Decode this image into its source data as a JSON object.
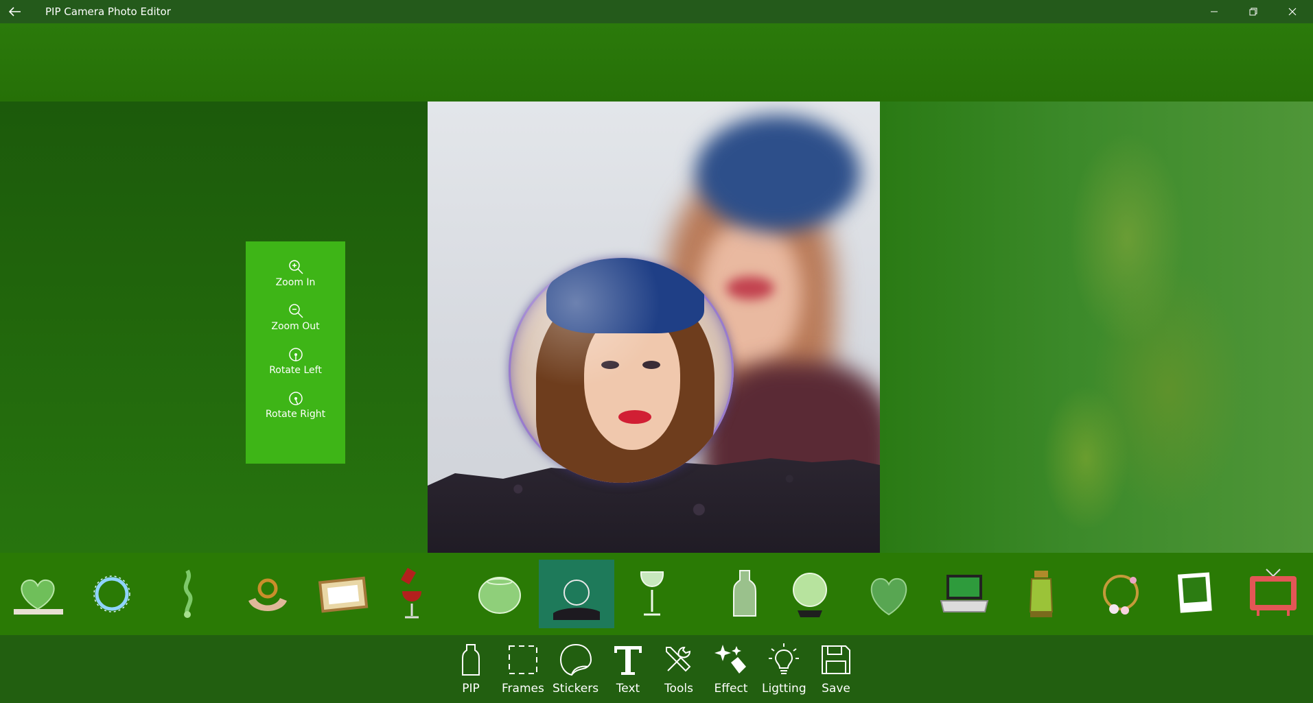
{
  "window": {
    "title": "PIP Camera Photo Editor",
    "back_icon": "back-arrow-icon",
    "controls": [
      "minimize-icon",
      "restore-icon",
      "close-icon"
    ]
  },
  "tools_panel": {
    "items": [
      {
        "label": "Zoom In",
        "icon": "zoom-in-icon"
      },
      {
        "label": "Zoom Out",
        "icon": "zoom-out-icon"
      },
      {
        "label": "Rotate Left",
        "icon": "rotate-left-icon"
      },
      {
        "label": "Rotate Right",
        "icon": "rotate-right-icon"
      }
    ]
  },
  "stickers": {
    "selected_index": 7,
    "items": [
      {
        "icon": "glass-heart-icon"
      },
      {
        "icon": "water-ring-icon"
      },
      {
        "icon": "water-splash-icon"
      },
      {
        "icon": "hands-ring-icon"
      },
      {
        "icon": "wooden-frame-icon"
      },
      {
        "icon": "wine-glass-pour-icon"
      },
      {
        "icon": "fishbowl-icon"
      },
      {
        "icon": "glass-bubble-on-rock-icon"
      },
      {
        "icon": "wine-glass-icon"
      },
      {
        "icon": "milk-bottle-icon"
      },
      {
        "icon": "crystal-ball-icon"
      },
      {
        "icon": "heart-glass-icon"
      },
      {
        "icon": "laptop-icon"
      },
      {
        "icon": "lantern-icon"
      },
      {
        "icon": "flower-wreath-icon"
      },
      {
        "icon": "polaroid-frame-icon"
      },
      {
        "icon": "red-tv-icon"
      }
    ]
  },
  "bottom_nav": {
    "items": [
      {
        "label": "PIP",
        "icon": "bottle-icon"
      },
      {
        "label": "Frames",
        "icon": "frames-icon"
      },
      {
        "label": "Stickers",
        "icon": "sticker-icon"
      },
      {
        "label": "Text",
        "icon": "text-icon"
      },
      {
        "label": "Tools",
        "icon": "tools-icon"
      },
      {
        "label": "Effect",
        "icon": "effect-icon"
      },
      {
        "label": "Ligtting",
        "icon": "lightbulb-icon"
      },
      {
        "label": "Save",
        "icon": "save-icon"
      }
    ]
  },
  "colors": {
    "accent_panel": "#3eb517",
    "sticker_strip": "#2a7a05",
    "bottom_bar": "#225f10",
    "selected_sticker": "#1e7a5a"
  }
}
